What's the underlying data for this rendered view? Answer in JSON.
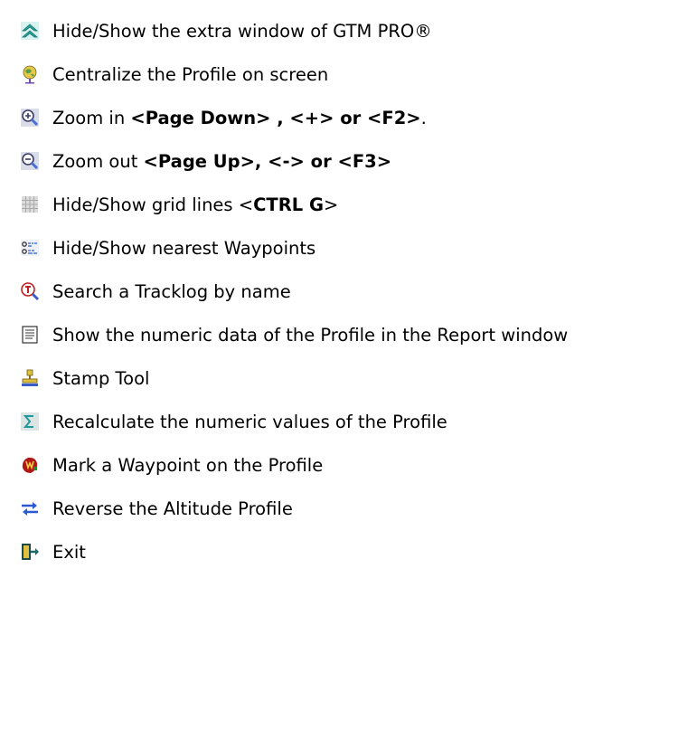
{
  "items": [
    {
      "icon": "double-up-arrow-icon",
      "segments": [
        {
          "text": "Hide/Show the extra window of GTM PRO®",
          "bold": false
        }
      ]
    },
    {
      "icon": "globe-pin-icon",
      "segments": [
        {
          "text": "Centralize the Profile on screen",
          "bold": false
        }
      ]
    },
    {
      "icon": "zoom-in-icon",
      "segments": [
        {
          "text": "Zoom in ",
          "bold": false
        },
        {
          "text": "<Page Down> , <+> or <F2>",
          "bold": true
        },
        {
          "text": ".",
          "bold": false
        }
      ]
    },
    {
      "icon": "zoom-out-icon",
      "segments": [
        {
          "text": "Zoom out ",
          "bold": false
        },
        {
          "text": "<Page Up>, <-> or <F3>",
          "bold": true
        }
      ]
    },
    {
      "icon": "grid-icon",
      "segments": [
        {
          "text": "Hide/Show grid lines <",
          "bold": false
        },
        {
          "text": "CTRL G",
          "bold": true
        },
        {
          "text": ">",
          "bold": false
        }
      ]
    },
    {
      "icon": "waypoints-list-icon",
      "segments": [
        {
          "text": "Hide/Show nearest Waypoints",
          "bold": false
        }
      ]
    },
    {
      "icon": "search-tracklog-icon",
      "segments": [
        {
          "text": "Search a Tracklog by name",
          "bold": false
        }
      ]
    },
    {
      "icon": "report-document-icon",
      "segments": [
        {
          "text": "Show the numeric data of the Profile in the Report window",
          "bold": false
        }
      ]
    },
    {
      "icon": "stamp-icon",
      "segments": [
        {
          "text": "Stamp Tool",
          "bold": false
        }
      ]
    },
    {
      "icon": "sigma-icon",
      "segments": [
        {
          "text": "Recalculate the numeric values of the Profile",
          "bold": false
        }
      ]
    },
    {
      "icon": "waypoint-marker-icon",
      "segments": [
        {
          "text": "Mark a Waypoint on the Profile",
          "bold": false
        }
      ]
    },
    {
      "icon": "reverse-arrows-icon",
      "segments": [
        {
          "text": "Reverse the Altitude Profile",
          "bold": false
        }
      ]
    },
    {
      "icon": "exit-door-icon",
      "segments": [
        {
          "text": "Exit",
          "bold": false
        }
      ]
    }
  ]
}
